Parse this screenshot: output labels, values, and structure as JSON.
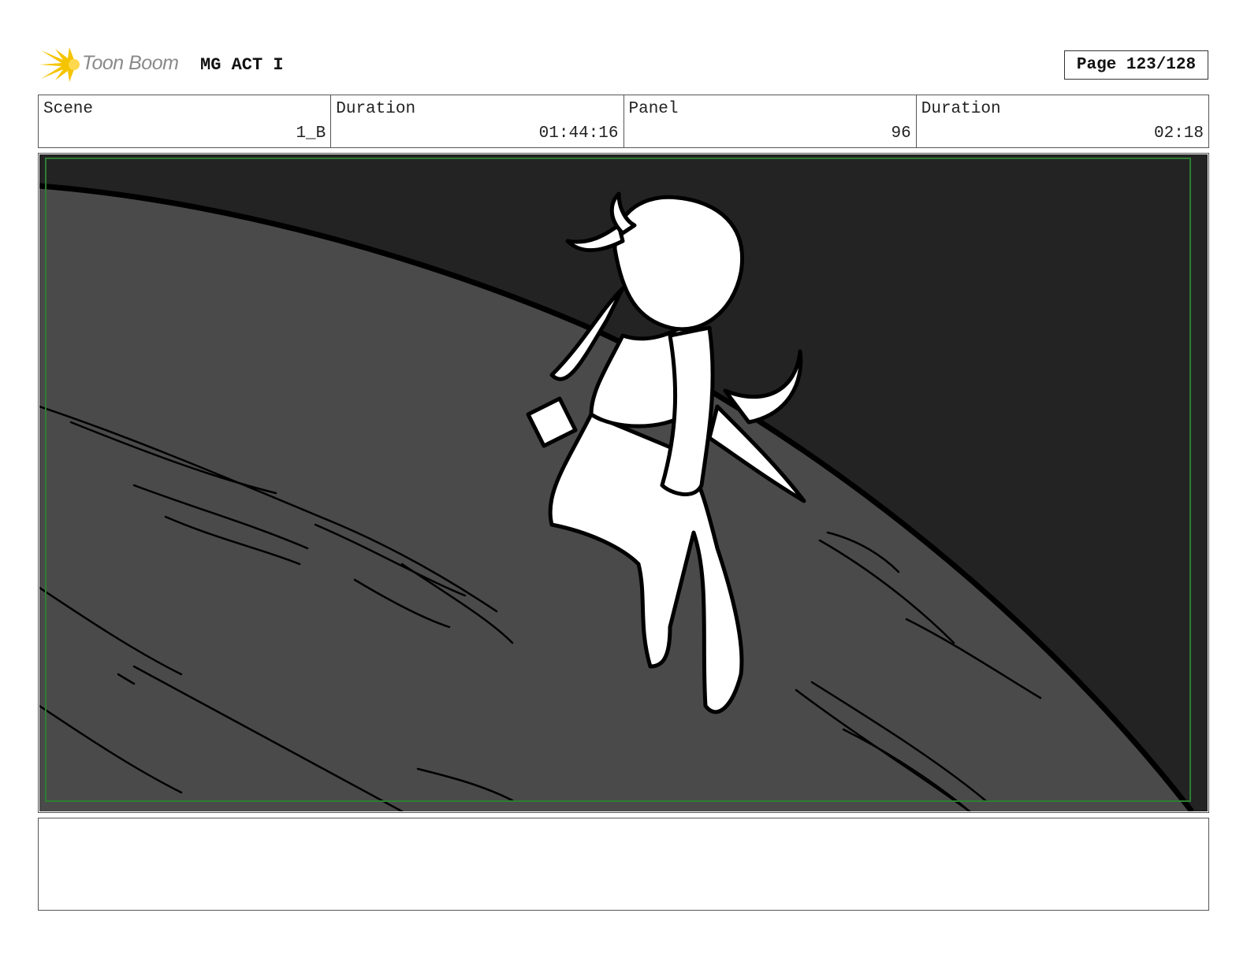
{
  "header": {
    "brand": "Toon Boom",
    "title": "MG ACT I",
    "page_label": "Page 123/128"
  },
  "info": {
    "scene_label": "Scene",
    "scene_value": "1_B",
    "duration_label": "Duration",
    "duration_value": "01:44:16",
    "panel_label": "Panel",
    "panel_value": "96",
    "panel_duration_label": "Duration",
    "panel_duration_value": "02:18"
  },
  "panel": {
    "image": "storyboard-sketch-character-floating-over-planet",
    "safe_area_color": "#2e7d32",
    "sky_color": "#232323",
    "planet_color": "#4a4a4a"
  },
  "notes": {
    "text": ""
  },
  "colors": {
    "logo_yellow": "#f5c400",
    "brand_gray": "#8a8a8a"
  }
}
